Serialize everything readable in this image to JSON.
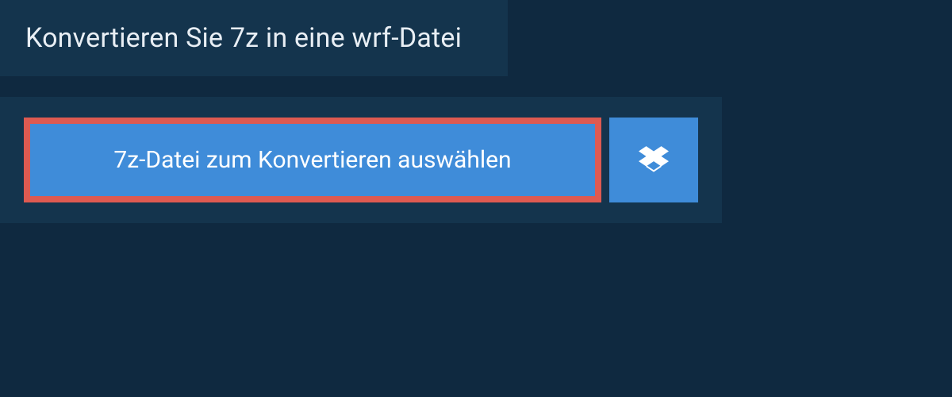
{
  "header": {
    "title": "Konvertieren Sie 7z in eine wrf-Datei"
  },
  "actions": {
    "select_file_label": "7z-Datei zum Konvertieren auswählen",
    "dropbox_icon": "dropbox-icon"
  },
  "colors": {
    "background": "#0f2940",
    "panel": "#14344d",
    "button_primary": "#3f8cd9",
    "highlight_border": "#de5a51",
    "text_light": "#e8eef4"
  }
}
